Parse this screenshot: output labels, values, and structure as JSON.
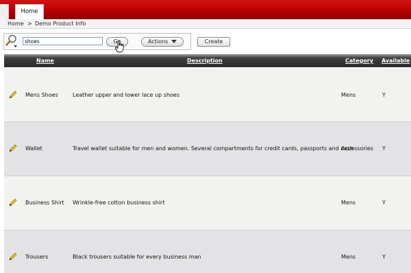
{
  "tabs": [
    {
      "label": "Home"
    }
  ],
  "breadcrumb": {
    "home": "Home",
    "separator": ">",
    "current": "Demo Product Info"
  },
  "search": {
    "value": "shoes",
    "go_label": "Go",
    "actions_label": "Actions",
    "create_label": "Create"
  },
  "table": {
    "columns": [
      "Name",
      "Description",
      "Category",
      "Available"
    ],
    "rows": [
      {
        "name": "Mens Shoes",
        "description": "Leather upper and lower lace up shoes",
        "category": "Mens",
        "available": "Y"
      },
      {
        "name": "Wallet",
        "description": "Travel wallet suitable for men and women. Several compartments for credit cards, passports and cash",
        "category": "Accessories",
        "available": "Y"
      },
      {
        "name": "Business Shirt",
        "description": "Wrinkle-free cotton business shirt",
        "category": "Mens",
        "available": "Y"
      },
      {
        "name": "Trousers",
        "description": "Black trousers suitable for every business man",
        "category": "Mens",
        "available": "Y"
      }
    ]
  },
  "icons": {
    "search": "magnifier-icon",
    "edit": "pencil-edit-icon",
    "dropdown": "triangle-down-icon",
    "cursor": "hand-pointer-icon"
  },
  "colors": {
    "brand": "#b80000",
    "header_bg": "#2b2b2b",
    "row_odd": "#f2f3f0",
    "row_even": "#e3e2e5"
  }
}
